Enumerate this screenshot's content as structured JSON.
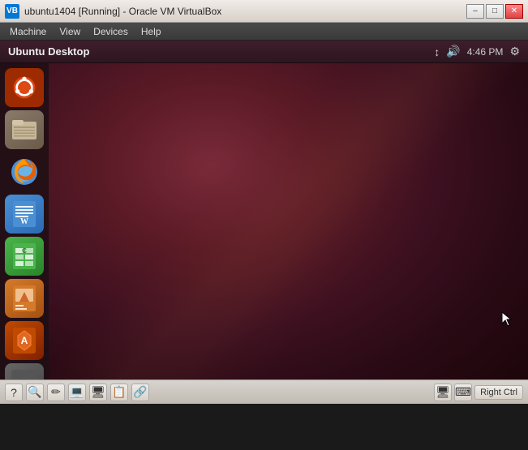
{
  "window": {
    "title": "ubuntu1404 [Running] - Oracle VM VirtualBox",
    "icon": "VB"
  },
  "titlebar": {
    "minimize_label": "–",
    "maximize_label": "□",
    "close_label": "✕"
  },
  "menubar": {
    "items": [
      "Machine",
      "View",
      "Devices",
      "Help"
    ]
  },
  "ubuntu_topbar": {
    "desktop_label": "Ubuntu Desktop",
    "time": "4:46 PM",
    "icons": [
      "↕",
      "🔊",
      "⚙"
    ]
  },
  "launcher": {
    "icons": [
      {
        "id": "ubuntu-home",
        "tooltip": "Ubuntu Home"
      },
      {
        "id": "file-manager",
        "tooltip": "Files"
      },
      {
        "id": "firefox",
        "tooltip": "Firefox Web Browser"
      },
      {
        "id": "libreoffice-writer",
        "tooltip": "LibreOffice Writer"
      },
      {
        "id": "libreoffice-calc",
        "tooltip": "LibreOffice Calc"
      },
      {
        "id": "libreoffice-impress",
        "tooltip": "LibreOffice Impress"
      },
      {
        "id": "ubuntu-software",
        "tooltip": "Ubuntu Software Center"
      },
      {
        "id": "amazon",
        "tooltip": "Amazon"
      }
    ]
  },
  "taskbar": {
    "icons": [
      "?",
      "🔍",
      "✏",
      "💻",
      "🖥",
      "📋",
      "🔗"
    ],
    "right_ctrl": "Right Ctrl"
  }
}
